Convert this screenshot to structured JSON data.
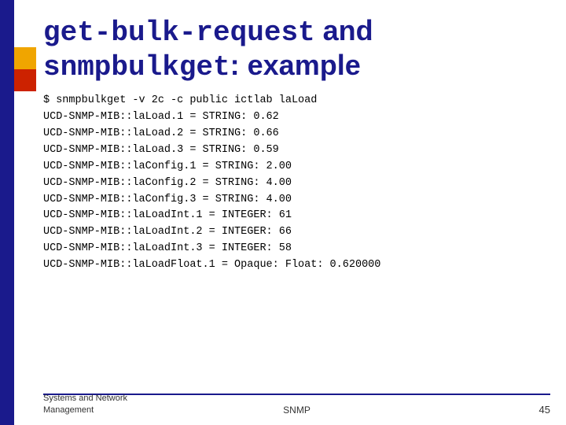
{
  "slide": {
    "accent_bar": true,
    "title": {
      "part1_mono": "get-bulk-request",
      "part1_text": " and",
      "part2_mono": "snmpbulkget",
      "part2_text": ": example"
    },
    "code_lines": [
      "$ snmpbulkget -v 2c -c public ictlab laLoad",
      "UCD-SNMP-MIB::laLoad.1 = STRING: 0.62",
      "UCD-SNMP-MIB::laLoad.2 = STRING: 0.66",
      "UCD-SNMP-MIB::laLoad.3 = STRING: 0.59",
      "UCD-SNMP-MIB::laConfig.1 = STRING: 2.00",
      "UCD-SNMP-MIB::laConfig.2 = STRING: 4.00",
      "UCD-SNMP-MIB::laConfig.3 = STRING: 4.00",
      "UCD-SNMP-MIB::laLoadInt.1 = INTEGER: 61",
      "UCD-SNMP-MIB::laLoadInt.2 = INTEGER: 66",
      "UCD-SNMP-MIB::laLoadInt.3 = INTEGER: 58",
      "UCD-SNMP-MIB::laLoadFloat.1 = Opaque: Float: 0.620000"
    ],
    "footer": {
      "left_line1": "Systems and Network",
      "left_line2": "Management",
      "center": "SNMP",
      "right": "45"
    }
  }
}
